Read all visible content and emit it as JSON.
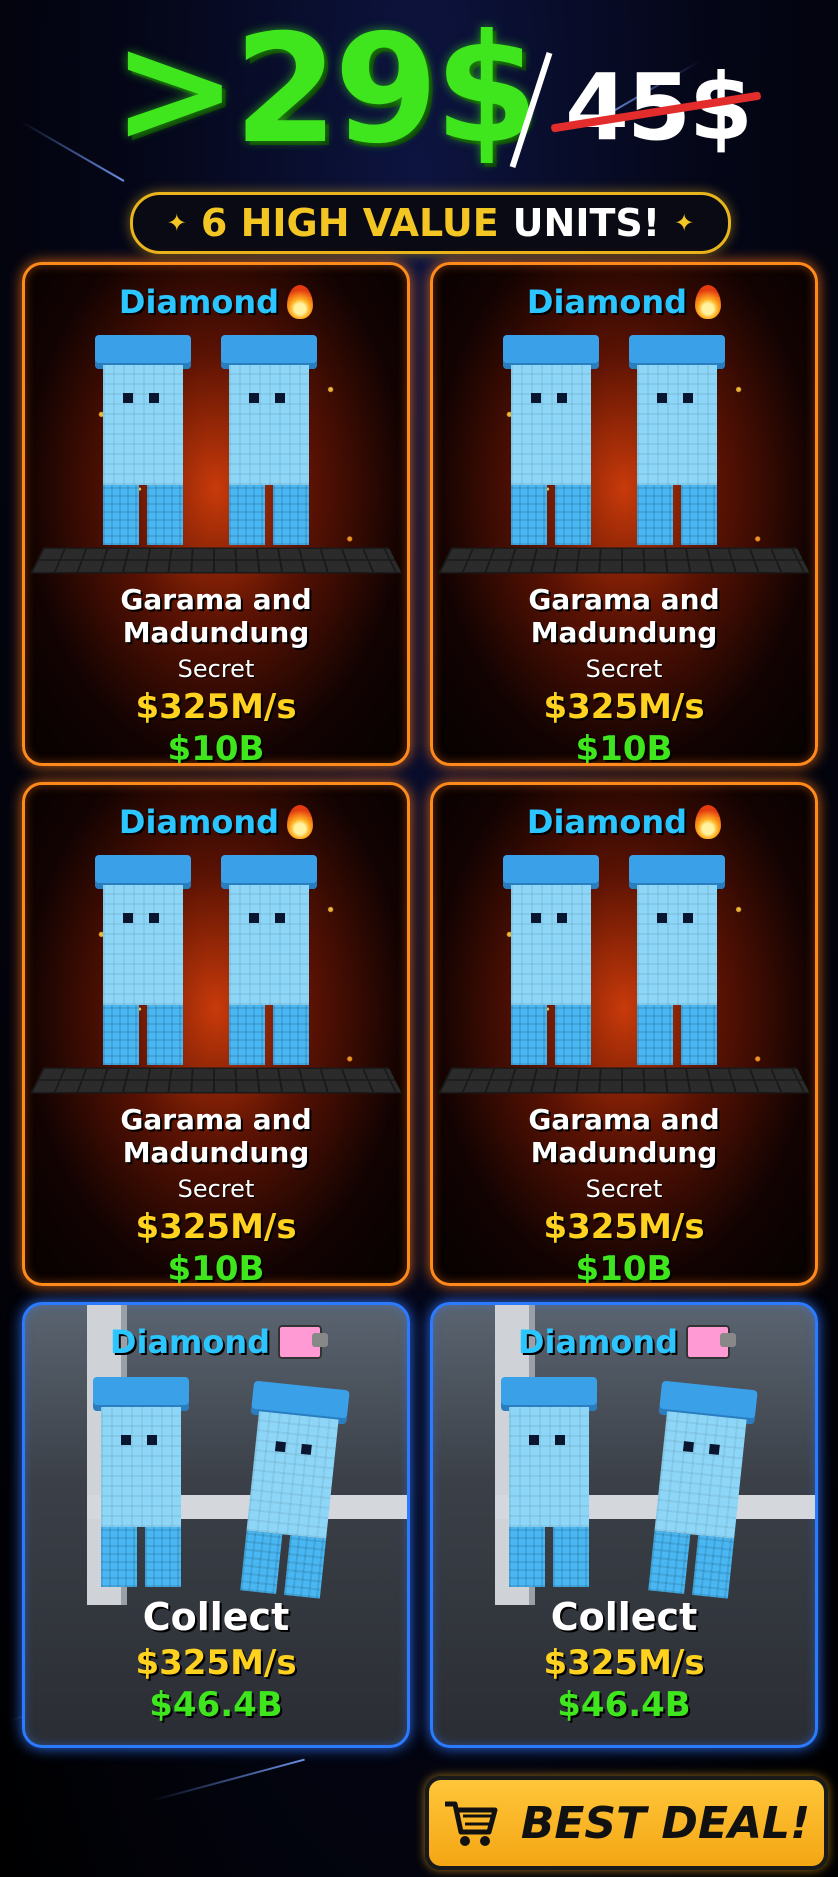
{
  "header": {
    "new_price": ">29$",
    "old_price": "45$",
    "banner_part1": "6 HIGH VALUE",
    "banner_part2": "UNITS!",
    "banner_star": "✦"
  },
  "cards": [
    {
      "tier": "Diamond",
      "badge": "fire-icon",
      "name": "Garama and Madundung",
      "rarity": "Secret",
      "rate": "$325M/s",
      "value": "$10B"
    },
    {
      "tier": "Diamond",
      "badge": "fire-icon",
      "name": "Garama and Madundung",
      "rarity": "Secret",
      "rate": "$325M/s",
      "value": "$10B"
    },
    {
      "tier": "Diamond",
      "badge": "fire-icon",
      "name": "Garama and Madundung",
      "rarity": "Secret",
      "rate": "$325M/s",
      "value": "$10B"
    },
    {
      "tier": "Diamond",
      "badge": "fire-icon",
      "name": "Garama and Madundung",
      "rarity": "Secret",
      "rate": "$325M/s",
      "value": "$10B"
    },
    {
      "tier": "Diamond",
      "badge": "nyan-cat-icon",
      "name": "Collect",
      "rate": "$325M/s",
      "value": "$46.4B"
    },
    {
      "tier": "Diamond",
      "badge": "nyan-cat-icon",
      "name": "Collect",
      "rate": "$325M/s",
      "value": "$46.4B"
    }
  ],
  "cta": {
    "label": "BEST DEAL!",
    "icon": "cart-icon"
  },
  "colors": {
    "green": "#3fe61d",
    "gold": "#ffd21f",
    "cyan": "#2bc6ff",
    "orange_border": "#ff8a1c",
    "blue_border": "#2a7bff"
  }
}
